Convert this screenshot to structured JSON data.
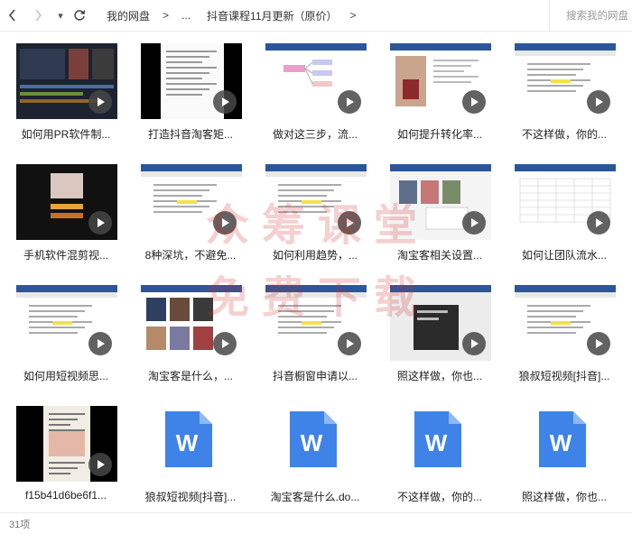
{
  "nav": {
    "back": "‹",
    "forward": "›",
    "dropdown": "▾",
    "refresh": "↻"
  },
  "breadcrumb": {
    "root": "我的网盘",
    "sep1": ">",
    "ellipsis": "...",
    "current": "抖音课程11月更新（原价）",
    "sep2": ">"
  },
  "search": {
    "placeholder": "搜索我的网盘"
  },
  "files": [
    {
      "name": "如何用PR软件制...",
      "kind": "video",
      "theme": "editor"
    },
    {
      "name": "打造抖音淘客矩...",
      "kind": "video",
      "theme": "doc-dark"
    },
    {
      "name": "做对这三步，流...",
      "kind": "video",
      "theme": "mindmap"
    },
    {
      "name": "如何提升转化率...",
      "kind": "video",
      "theme": "photo"
    },
    {
      "name": "不这样做，你的...",
      "kind": "video",
      "theme": "doc"
    },
    {
      "name": "手机软件混剪视...",
      "kind": "video",
      "theme": "phone"
    },
    {
      "name": "8种深坑，不避免...",
      "kind": "video",
      "theme": "doc"
    },
    {
      "name": "如何利用趋势，...",
      "kind": "video",
      "theme": "doc"
    },
    {
      "name": "淘宝客相关设置...",
      "kind": "video",
      "theme": "web"
    },
    {
      "name": "如何让团队流水...",
      "kind": "video",
      "theme": "sheet"
    },
    {
      "name": "如何用短视频思...",
      "kind": "video",
      "theme": "doc"
    },
    {
      "name": "淘宝客是什么，...",
      "kind": "video",
      "theme": "shop"
    },
    {
      "name": "抖音橱窗申请以...",
      "kind": "video",
      "theme": "doc"
    },
    {
      "name": "照这样做，你也...",
      "kind": "video",
      "theme": "dialog"
    },
    {
      "name": "狼叔短视频[抖音]...",
      "kind": "video",
      "theme": "doc"
    },
    {
      "name": "f15b41d6be6f1...",
      "kind": "video",
      "theme": "phone2"
    },
    {
      "name": "狼叔短视频[抖音]...",
      "kind": "doc",
      "theme": "word"
    },
    {
      "name": "淘宝客是什么.do...",
      "kind": "doc",
      "theme": "word"
    },
    {
      "name": "不这样做，你的...",
      "kind": "doc",
      "theme": "word"
    },
    {
      "name": "照这样做，你也...",
      "kind": "doc",
      "theme": "word"
    }
  ],
  "status": {
    "count": "31项"
  },
  "colors": {
    "word_blue": "#3f83e8",
    "play_bg": "#464646"
  },
  "watermark": {
    "line1": "众筹课堂",
    "line2": "免费下载"
  }
}
